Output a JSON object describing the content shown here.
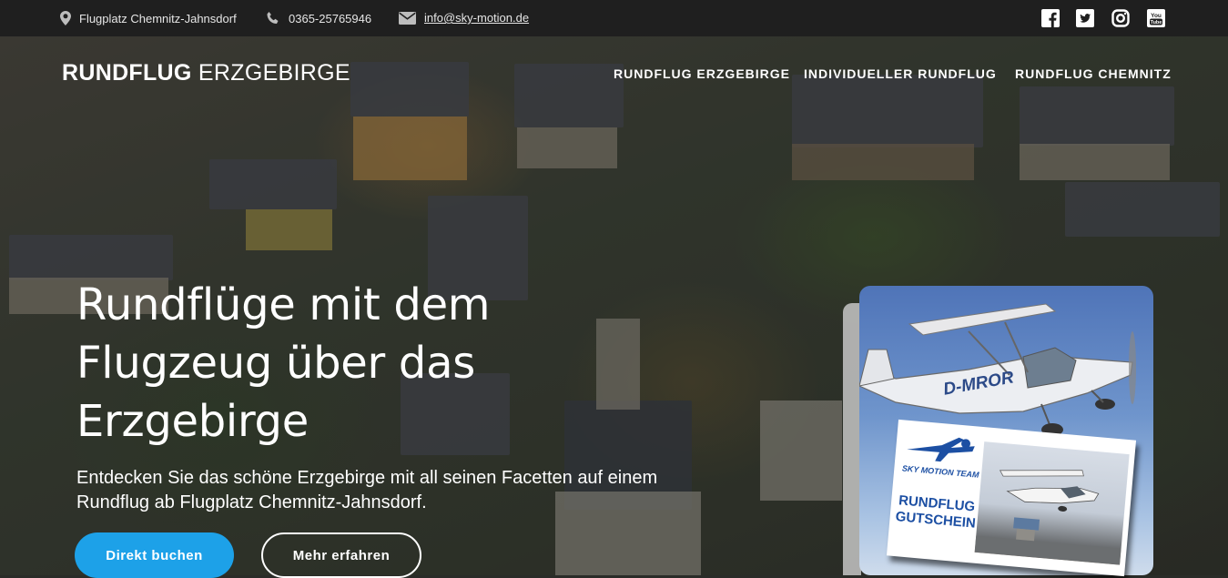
{
  "topbar": {
    "address": "Flugplatz Chemnitz-Jahnsdorf",
    "phone": "0365-25765946",
    "email": "info@sky-motion.de",
    "social": [
      "facebook-icon",
      "twitter-icon",
      "instagram-icon",
      "youtube-icon"
    ],
    "youtube_text": "You Tube"
  },
  "brand": {
    "strong": "RUNDFLUG",
    "light": "ERZGEBIRGE"
  },
  "nav": {
    "items": [
      {
        "label": "RUNDFLUG ERZGEBIRGE"
      },
      {
        "label": "INDIVIDUELLER RUNDFLUG"
      },
      {
        "label": "RUNDFLUG CHEMNITZ"
      }
    ]
  },
  "hero": {
    "headline": "Rundflüge mit dem Flugzeug über das Erzgebirge",
    "lead": "Entdecken Sie das schöne Erzgebirge mit all seinen Facetten auf einem Rundflug ab Flugplatz Chemnitz-Jahnsdorf.",
    "primary_button": "Direkt buchen",
    "secondary_button": "Mehr erfahren"
  },
  "promo": {
    "aircraft_registration": "D-MROR",
    "voucher_team": "SKY MOTION TEAM",
    "voucher_title": "RUNDFLUG GUTSCHEIN"
  },
  "colors": {
    "topbar_bg": "#1f1f1f",
    "accent": "#1da1e8",
    "voucher_blue": "#1c4fa3"
  }
}
